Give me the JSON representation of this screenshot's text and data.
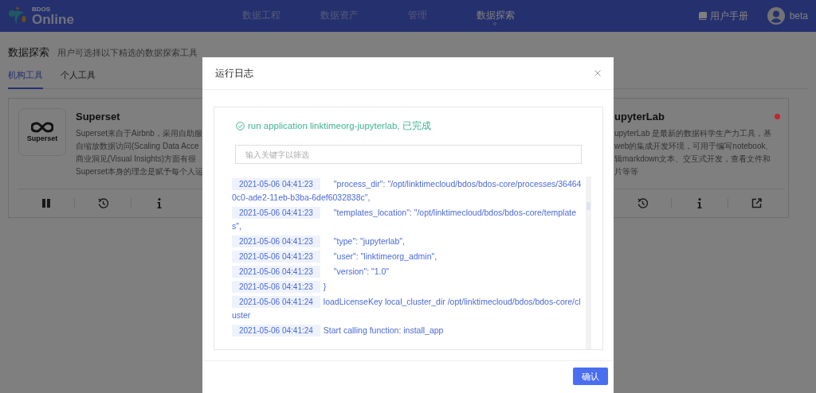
{
  "header": {
    "logo_small": "BDOS",
    "logo": "Online",
    "nav": [
      {
        "label": "数据工程",
        "selected": false
      },
      {
        "label": "数据资产",
        "selected": false
      },
      {
        "label": "管理",
        "selected": false
      },
      {
        "label": "数据探索",
        "selected": true
      }
    ],
    "manual": "用户手册",
    "user": "beta"
  },
  "page": {
    "title": "数据探索",
    "subtitle": "用户可选择以下精选的数据探索工具",
    "tabs": [
      {
        "label": "机构工具",
        "selected": true
      },
      {
        "label": "个人工具",
        "selected": false
      }
    ]
  },
  "cards": [
    {
      "title": "Superset",
      "logo_text": "Superset",
      "description_lines": [
        "Superset来自于Airbnb，采用自助服",
        "自缩放数据访问(Scaling Data Acce",
        "商业洞见(Visual Insights)方面有很",
        "Superset本身的理念是赋予每个人运"
      ],
      "actions": [
        {
          "kind": "pause"
        },
        {
          "kind": "history"
        },
        {
          "kind": "info"
        }
      ]
    },
    {
      "title": "upyterLab",
      "color": "#c4242b",
      "description_lines": [
        "upyterLab 是最新的数据科学生产力工具，基",
        "web的集成开发环境，可用于编写notebook、",
        "辑markdown文本、交互式开发，查看文件和",
        "片等等"
      ],
      "actions": [
        {
          "kind": "history"
        },
        {
          "kind": "info"
        },
        {
          "kind": "open-external"
        }
      ]
    }
  ],
  "modal": {
    "title": "运行日志",
    "status": {
      "kind": "success",
      "text": "run application linktimeorg-jupyterlab, 已完成"
    },
    "filter_placeholder": "输入关键字以筛选",
    "logs": [
      {
        "time": "2021-05-06 04:41:23",
        "message": "\"process_dir\": \"/opt/linktimecloud/bdos/bdos-core/processes/364640c0-ade2-11eb-b3ba-6def6032838c\",",
        "indented": true
      },
      {
        "time": "2021-05-06 04:41:23",
        "message": "\"templates_location\": \"/opt/linktimecloud/bdos/bdos-core/templates\",",
        "indented": true
      },
      {
        "time": "2021-05-06 04:41:23",
        "message": "\"type\": \"jupyterlab\",",
        "indented": true
      },
      {
        "time": "2021-05-06 04:41:23",
        "message": "\"user\": \"linktimeorg_admin\",",
        "indented": true
      },
      {
        "time": "2021-05-06 04:41:23",
        "message": "\"version\": \"1.0\"",
        "indented": true
      },
      {
        "time": "2021-05-06 04:41:23",
        "message": "}",
        "indented": false
      },
      {
        "time": "2021-05-06 04:41:24",
        "message": "loadLicenseKey local_cluster_dir /opt/linktimecloud/bdos/bdos-core/cluster",
        "indented": false
      },
      {
        "time": "2021-05-06 04:41:24",
        "message": "Start calling function: install_app",
        "indented": false
      }
    ],
    "confirm": "确认"
  }
}
